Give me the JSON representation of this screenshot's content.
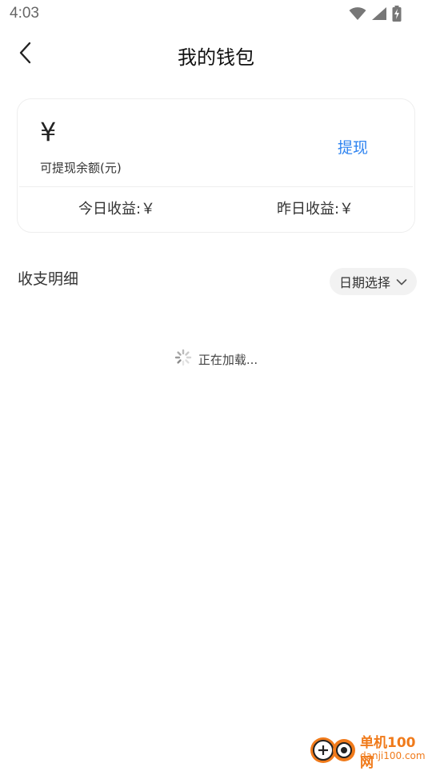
{
  "status_bar": {
    "time": "4:03",
    "icons": [
      "wifi-icon",
      "signal-icon",
      "battery-charging-icon"
    ]
  },
  "header": {
    "title": "我的钱包",
    "back_icon": "chevron-left-icon"
  },
  "wallet": {
    "balance": "¥",
    "balance_label": "可提现余额(元)",
    "withdraw_label": "提现",
    "today_earnings": "今日收益:￥",
    "yesterday_earnings": "昨日收益:￥"
  },
  "transactions": {
    "title": "收支明细",
    "date_filter_label": "日期选择",
    "loading_text": "正在加载..."
  },
  "watermark": {
    "cn": "单机100网",
    "en": "danji100.com"
  },
  "colors": {
    "accent": "#2f84f0",
    "watermark": "#f07a1a",
    "card_border": "#eeeeee"
  }
}
